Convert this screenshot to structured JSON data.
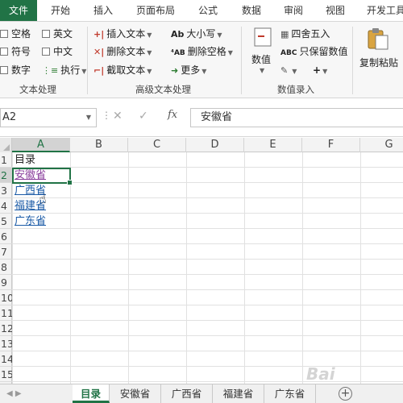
{
  "menu_tabs": [
    "文件",
    "开始",
    "插入",
    "页面布局",
    "公式",
    "数据",
    "审阅",
    "视图",
    "开发工具"
  ],
  "ribbon": {
    "text_process": {
      "items": [
        "空格",
        "英文",
        "符号",
        "中文",
        "数字",
        "执行"
      ],
      "group_label": "文本处理"
    },
    "advanced_text": {
      "items": [
        "插入文本",
        "删除文本",
        "截取文本",
        "大小写",
        "删除空格",
        "更多"
      ],
      "group_label": "高级文本处理"
    },
    "numeric_entry": {
      "value_label": "数值",
      "round_label": "四舍五入",
      "keep_value_label": "只保留数值",
      "plus_label": "+",
      "group_label": "数值录入"
    },
    "paste": {
      "label": "复制粘贴"
    }
  },
  "formula_bar": {
    "name_box": "A2",
    "fx": "fx",
    "content": "安徽省"
  },
  "columns": [
    "A",
    "B",
    "C",
    "D",
    "E",
    "F",
    "G"
  ],
  "rows": [
    "1",
    "2",
    "3",
    "4",
    "5",
    "6",
    "7",
    "8",
    "9",
    "10",
    "11",
    "12",
    "13",
    "14",
    "15"
  ],
  "cells": {
    "a1": "目录",
    "a2": "安徽省",
    "a3": "广西省",
    "a4": "福建省",
    "a5": "广东省"
  },
  "sheet_tabs": [
    "目录",
    "安徽省",
    "广西省",
    "福建省",
    "广东省"
  ],
  "colors": {
    "accent": "#217346",
    "link": "#1a5aa6",
    "visited_link": "#8a3f9c"
  },
  "watermark": "Bai"
}
